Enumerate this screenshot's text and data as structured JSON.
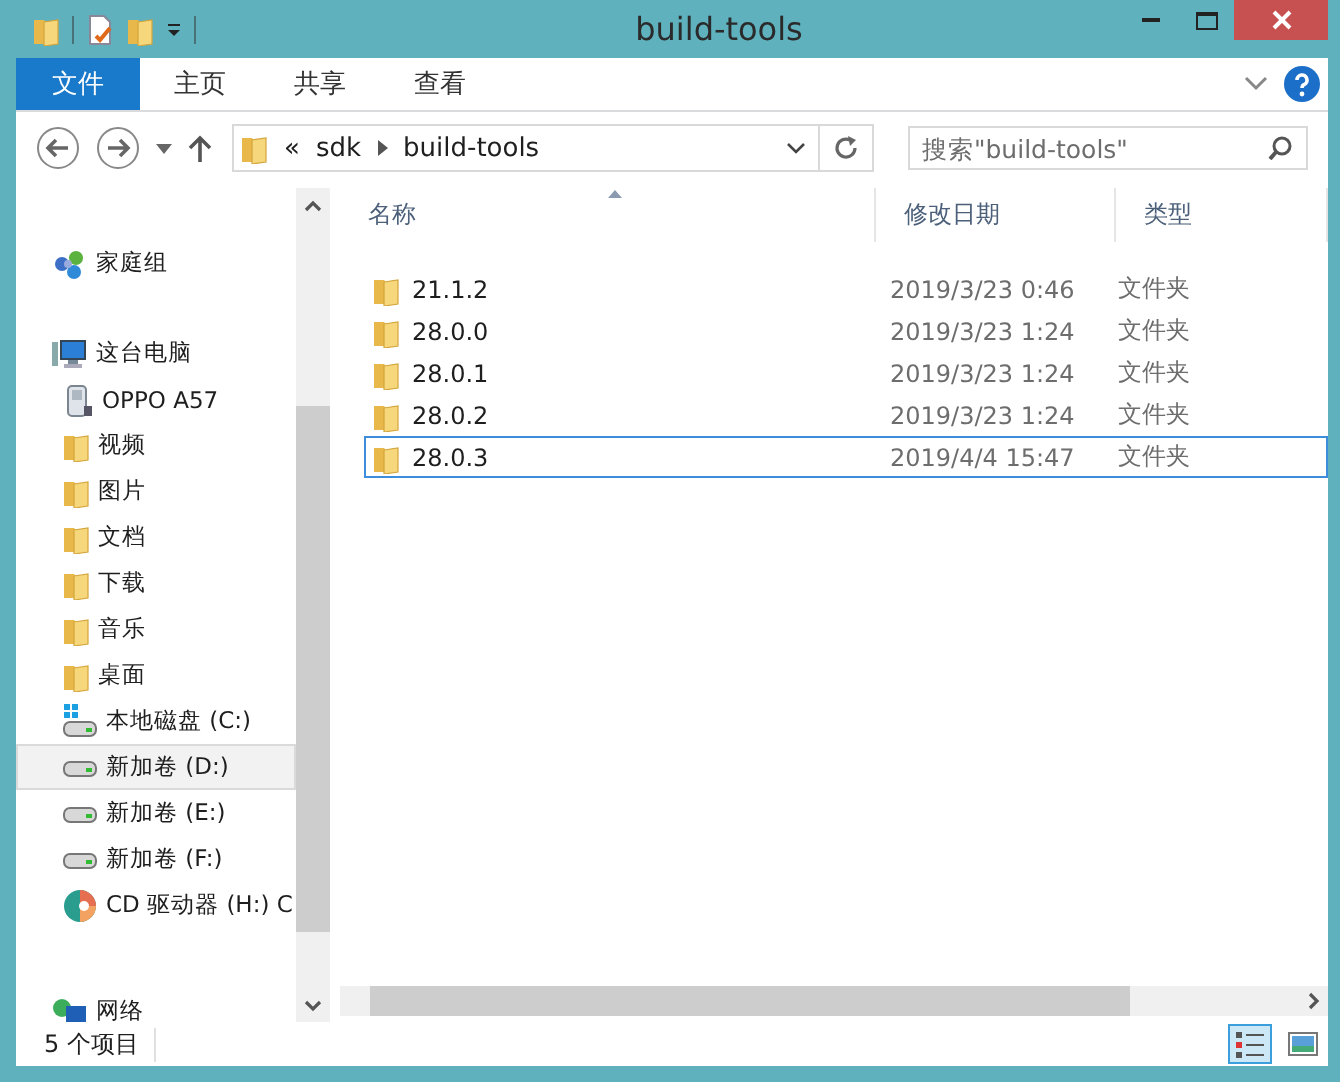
{
  "window": {
    "title": "build-tools"
  },
  "ribbon_tabs": [
    {
      "label": "文件",
      "selected": true
    },
    {
      "label": "主页",
      "selected": false
    },
    {
      "label": "共享",
      "selected": false
    },
    {
      "label": "查看",
      "selected": false
    }
  ],
  "address": {
    "overflow": "«",
    "crumbs": [
      "sdk",
      "build-tools"
    ]
  },
  "search": {
    "placeholder": "搜索\"build-tools\""
  },
  "nav": [
    {
      "label": "家庭组",
      "kind": "homegroup",
      "selected": false
    },
    {
      "label": "这台电脑",
      "kind": "computer",
      "selected": false,
      "children": [
        {
          "label": "OPPO A57",
          "kind": "phone",
          "selected": false
        },
        {
          "label": "视频",
          "kind": "folder",
          "selected": false
        },
        {
          "label": "图片",
          "kind": "folder",
          "selected": false
        },
        {
          "label": "文档",
          "kind": "folder",
          "selected": false
        },
        {
          "label": "下载",
          "kind": "folder",
          "selected": false
        },
        {
          "label": "音乐",
          "kind": "folder",
          "selected": false
        },
        {
          "label": "桌面",
          "kind": "folder",
          "selected": false
        },
        {
          "label": "本地磁盘 (C:)",
          "kind": "system-drive",
          "selected": false
        },
        {
          "label": "新加卷 (D:)",
          "kind": "drive",
          "selected": true
        },
        {
          "label": "新加卷 (E:)",
          "kind": "drive",
          "selected": false
        },
        {
          "label": "新加卷 (F:)",
          "kind": "drive",
          "selected": false
        },
        {
          "label": "CD 驱动器 (H:) C",
          "kind": "cd",
          "selected": false
        }
      ]
    },
    {
      "label": "网络",
      "kind": "network",
      "selected": false
    }
  ],
  "table": {
    "columns": [
      "名称",
      "修改日期",
      "类型"
    ],
    "rows": [
      {
        "name": "21.1.2",
        "modified": "2019/3/23 0:46",
        "type": "文件夹",
        "focused": false
      },
      {
        "name": "28.0.0",
        "modified": "2019/3/23 1:24",
        "type": "文件夹",
        "focused": false
      },
      {
        "name": "28.0.1",
        "modified": "2019/3/23 1:24",
        "type": "文件夹",
        "focused": false
      },
      {
        "name": "28.0.2",
        "modified": "2019/3/23 1:24",
        "type": "文件夹",
        "focused": false
      },
      {
        "name": "28.0.3",
        "modified": "2019/4/4 15:47",
        "type": "文件夹",
        "focused": true
      }
    ]
  },
  "status_bar": {
    "count": "5 个项目",
    "views": [
      {
        "kind": "details",
        "selected": true
      },
      {
        "kind": "large-icons",
        "selected": false
      }
    ]
  }
}
